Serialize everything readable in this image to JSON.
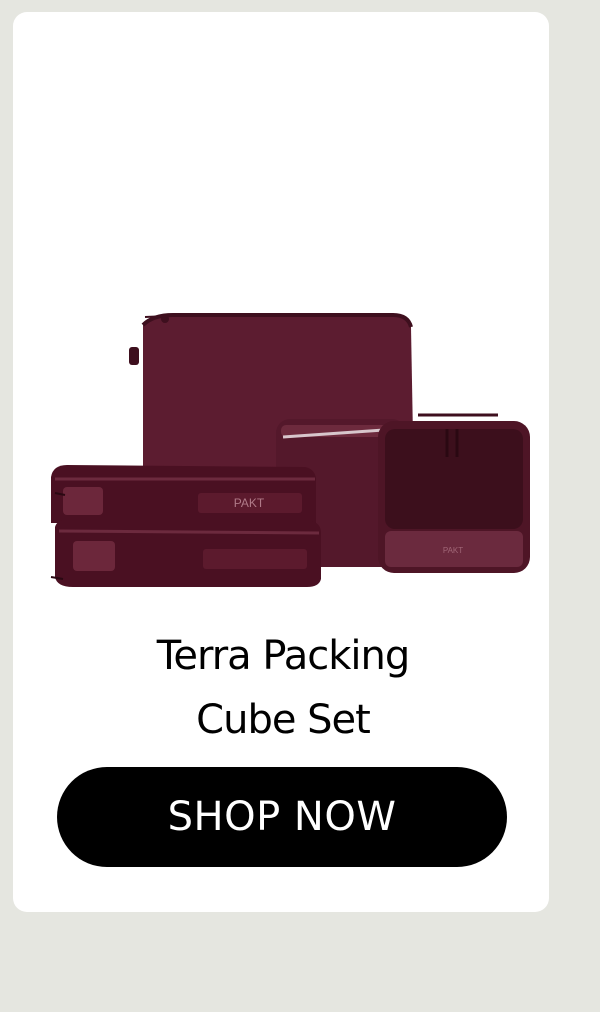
{
  "product": {
    "title_line1": "Terra Packing",
    "title_line2": "Cube Set",
    "image_icon": "packing-cube-set-illustration",
    "bag_color": "#5a1a2c",
    "logo_text": "PAKT"
  },
  "cta": {
    "label": "SHOP NOW"
  },
  "colors": {
    "page_bg": "#e5e6e0",
    "card_bg": "#ffffff",
    "button_bg": "#000000",
    "button_text": "#ffffff"
  }
}
